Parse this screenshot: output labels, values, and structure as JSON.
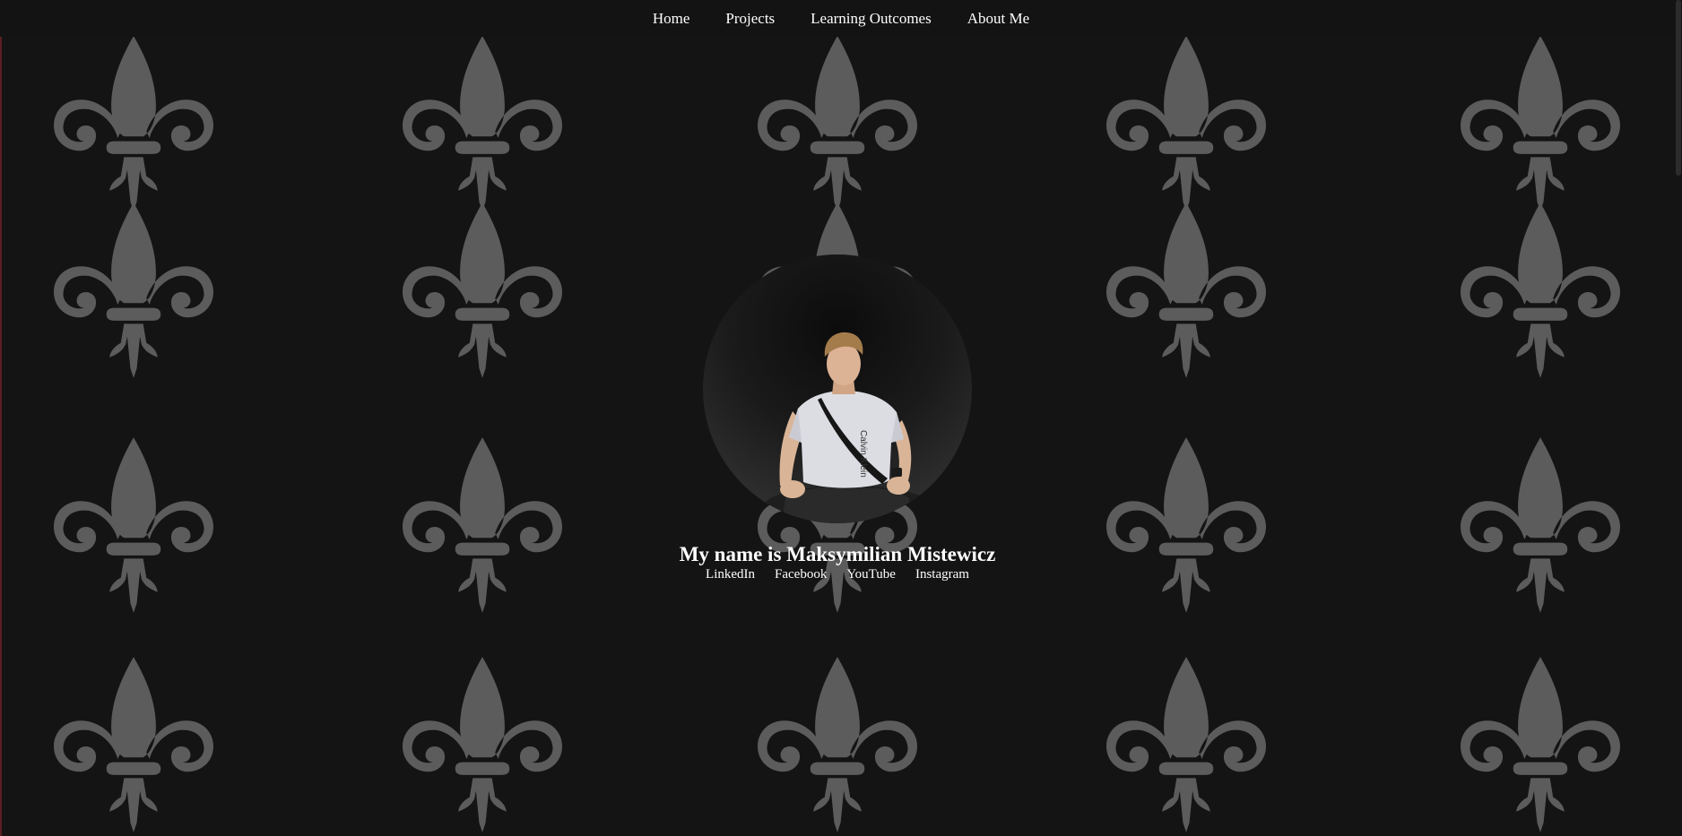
{
  "nav": {
    "items": [
      "Home",
      "Projects",
      "Learning Outcomes",
      "About Me"
    ]
  },
  "profile": {
    "heading": "My name is Maksymilian Mistewicz",
    "shirt_text": "Calvin Klein"
  },
  "social": {
    "links": [
      "LinkedIn",
      "Facebook",
      "YouTube",
      "Instagram"
    ]
  },
  "colors": {
    "background": "#141414",
    "pattern": "#5c5c5c",
    "text": "#ffffff"
  },
  "icons": {
    "pattern_motif": "fleur-de-lis-icon"
  }
}
